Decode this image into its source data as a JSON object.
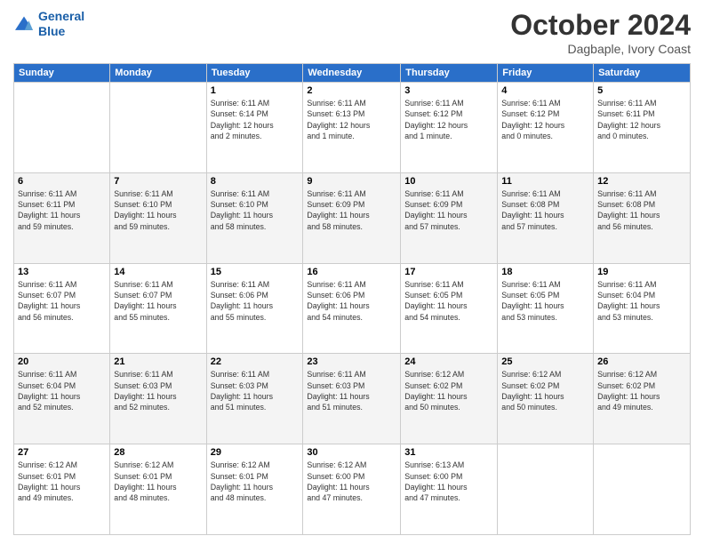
{
  "header": {
    "logo_line1": "General",
    "logo_line2": "Blue",
    "month": "October 2024",
    "location": "Dagbaple, Ivory Coast"
  },
  "weekdays": [
    "Sunday",
    "Monday",
    "Tuesday",
    "Wednesday",
    "Thursday",
    "Friday",
    "Saturday"
  ],
  "weeks": [
    [
      {
        "day": "",
        "info": ""
      },
      {
        "day": "",
        "info": ""
      },
      {
        "day": "1",
        "info": "Sunrise: 6:11 AM\nSunset: 6:14 PM\nDaylight: 12 hours\nand 2 minutes."
      },
      {
        "day": "2",
        "info": "Sunrise: 6:11 AM\nSunset: 6:13 PM\nDaylight: 12 hours\nand 1 minute."
      },
      {
        "day": "3",
        "info": "Sunrise: 6:11 AM\nSunset: 6:12 PM\nDaylight: 12 hours\nand 1 minute."
      },
      {
        "day": "4",
        "info": "Sunrise: 6:11 AM\nSunset: 6:12 PM\nDaylight: 12 hours\nand 0 minutes."
      },
      {
        "day": "5",
        "info": "Sunrise: 6:11 AM\nSunset: 6:11 PM\nDaylight: 12 hours\nand 0 minutes."
      }
    ],
    [
      {
        "day": "6",
        "info": "Sunrise: 6:11 AM\nSunset: 6:11 PM\nDaylight: 11 hours\nand 59 minutes."
      },
      {
        "day": "7",
        "info": "Sunrise: 6:11 AM\nSunset: 6:10 PM\nDaylight: 11 hours\nand 59 minutes."
      },
      {
        "day": "8",
        "info": "Sunrise: 6:11 AM\nSunset: 6:10 PM\nDaylight: 11 hours\nand 58 minutes."
      },
      {
        "day": "9",
        "info": "Sunrise: 6:11 AM\nSunset: 6:09 PM\nDaylight: 11 hours\nand 58 minutes."
      },
      {
        "day": "10",
        "info": "Sunrise: 6:11 AM\nSunset: 6:09 PM\nDaylight: 11 hours\nand 57 minutes."
      },
      {
        "day": "11",
        "info": "Sunrise: 6:11 AM\nSunset: 6:08 PM\nDaylight: 11 hours\nand 57 minutes."
      },
      {
        "day": "12",
        "info": "Sunrise: 6:11 AM\nSunset: 6:08 PM\nDaylight: 11 hours\nand 56 minutes."
      }
    ],
    [
      {
        "day": "13",
        "info": "Sunrise: 6:11 AM\nSunset: 6:07 PM\nDaylight: 11 hours\nand 56 minutes."
      },
      {
        "day": "14",
        "info": "Sunrise: 6:11 AM\nSunset: 6:07 PM\nDaylight: 11 hours\nand 55 minutes."
      },
      {
        "day": "15",
        "info": "Sunrise: 6:11 AM\nSunset: 6:06 PM\nDaylight: 11 hours\nand 55 minutes."
      },
      {
        "day": "16",
        "info": "Sunrise: 6:11 AM\nSunset: 6:06 PM\nDaylight: 11 hours\nand 54 minutes."
      },
      {
        "day": "17",
        "info": "Sunrise: 6:11 AM\nSunset: 6:05 PM\nDaylight: 11 hours\nand 54 minutes."
      },
      {
        "day": "18",
        "info": "Sunrise: 6:11 AM\nSunset: 6:05 PM\nDaylight: 11 hours\nand 53 minutes."
      },
      {
        "day": "19",
        "info": "Sunrise: 6:11 AM\nSunset: 6:04 PM\nDaylight: 11 hours\nand 53 minutes."
      }
    ],
    [
      {
        "day": "20",
        "info": "Sunrise: 6:11 AM\nSunset: 6:04 PM\nDaylight: 11 hours\nand 52 minutes."
      },
      {
        "day": "21",
        "info": "Sunrise: 6:11 AM\nSunset: 6:03 PM\nDaylight: 11 hours\nand 52 minutes."
      },
      {
        "day": "22",
        "info": "Sunrise: 6:11 AM\nSunset: 6:03 PM\nDaylight: 11 hours\nand 51 minutes."
      },
      {
        "day": "23",
        "info": "Sunrise: 6:11 AM\nSunset: 6:03 PM\nDaylight: 11 hours\nand 51 minutes."
      },
      {
        "day": "24",
        "info": "Sunrise: 6:12 AM\nSunset: 6:02 PM\nDaylight: 11 hours\nand 50 minutes."
      },
      {
        "day": "25",
        "info": "Sunrise: 6:12 AM\nSunset: 6:02 PM\nDaylight: 11 hours\nand 50 minutes."
      },
      {
        "day": "26",
        "info": "Sunrise: 6:12 AM\nSunset: 6:02 PM\nDaylight: 11 hours\nand 49 minutes."
      }
    ],
    [
      {
        "day": "27",
        "info": "Sunrise: 6:12 AM\nSunset: 6:01 PM\nDaylight: 11 hours\nand 49 minutes."
      },
      {
        "day": "28",
        "info": "Sunrise: 6:12 AM\nSunset: 6:01 PM\nDaylight: 11 hours\nand 48 minutes."
      },
      {
        "day": "29",
        "info": "Sunrise: 6:12 AM\nSunset: 6:01 PM\nDaylight: 11 hours\nand 48 minutes."
      },
      {
        "day": "30",
        "info": "Sunrise: 6:12 AM\nSunset: 6:00 PM\nDaylight: 11 hours\nand 47 minutes."
      },
      {
        "day": "31",
        "info": "Sunrise: 6:13 AM\nSunset: 6:00 PM\nDaylight: 11 hours\nand 47 minutes."
      },
      {
        "day": "",
        "info": ""
      },
      {
        "day": "",
        "info": ""
      }
    ]
  ]
}
